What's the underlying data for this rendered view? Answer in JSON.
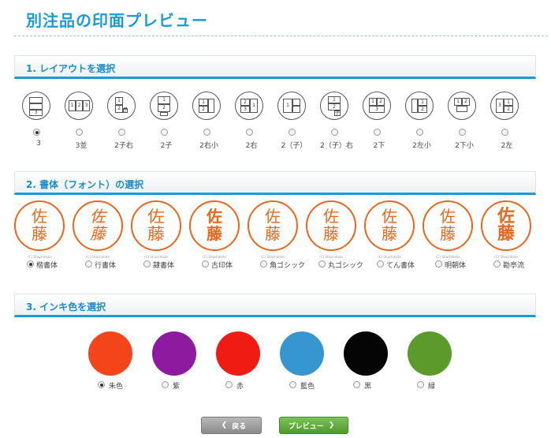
{
  "page_title": "別注品の印面プレビュー",
  "sections": {
    "layout": "1. レイアウトを選択",
    "font": "2. 書体（フォント）の選択",
    "ink": "3. インキ色を選択"
  },
  "layouts": [
    {
      "label": "3",
      "checked": true
    },
    {
      "label": "3並",
      "checked": false
    },
    {
      "label": "2子右",
      "checked": false
    },
    {
      "label": "2子",
      "checked": false
    },
    {
      "label": "2右小",
      "checked": false
    },
    {
      "label": "2右",
      "checked": false
    },
    {
      "label": "2（子）",
      "checked": false
    },
    {
      "label": "2（子）右",
      "checked": false
    },
    {
      "label": "2下",
      "checked": false
    },
    {
      "label": "2左小",
      "checked": false
    },
    {
      "label": "2下小",
      "checked": false
    },
    {
      "label": "2左",
      "checked": false
    }
  ],
  "seal_text": {
    "top": "佐",
    "bottom": "藤",
    "brand": "(C) Shachihata"
  },
  "fonts": [
    {
      "label": "楷書体",
      "checked": true
    },
    {
      "label": "行書体",
      "checked": false
    },
    {
      "label": "隷書体",
      "checked": false
    },
    {
      "label": "古印体",
      "checked": false
    },
    {
      "label": "角ゴシック",
      "checked": false
    },
    {
      "label": "丸ゴシック",
      "checked": false
    },
    {
      "label": "てん書体",
      "checked": false
    },
    {
      "label": "明朝体",
      "checked": false
    },
    {
      "label": "勘亭流",
      "checked": false
    }
  ],
  "inks": [
    {
      "label": "朱色",
      "color": "#f4441a",
      "checked": true
    },
    {
      "label": "紫",
      "color": "#8e1aa0",
      "checked": false
    },
    {
      "label": "赤",
      "color": "#f01c14",
      "checked": false
    },
    {
      "label": "藍色",
      "color": "#3596d0",
      "checked": false
    },
    {
      "label": "黒",
      "color": "#050505",
      "checked": false
    },
    {
      "label": "緑",
      "color": "#5c9a2c",
      "checked": false
    }
  ],
  "buttons": {
    "back": "戻る",
    "preview": "プレビュー",
    "back_arrow": "❮",
    "preview_arrow": "❯"
  }
}
